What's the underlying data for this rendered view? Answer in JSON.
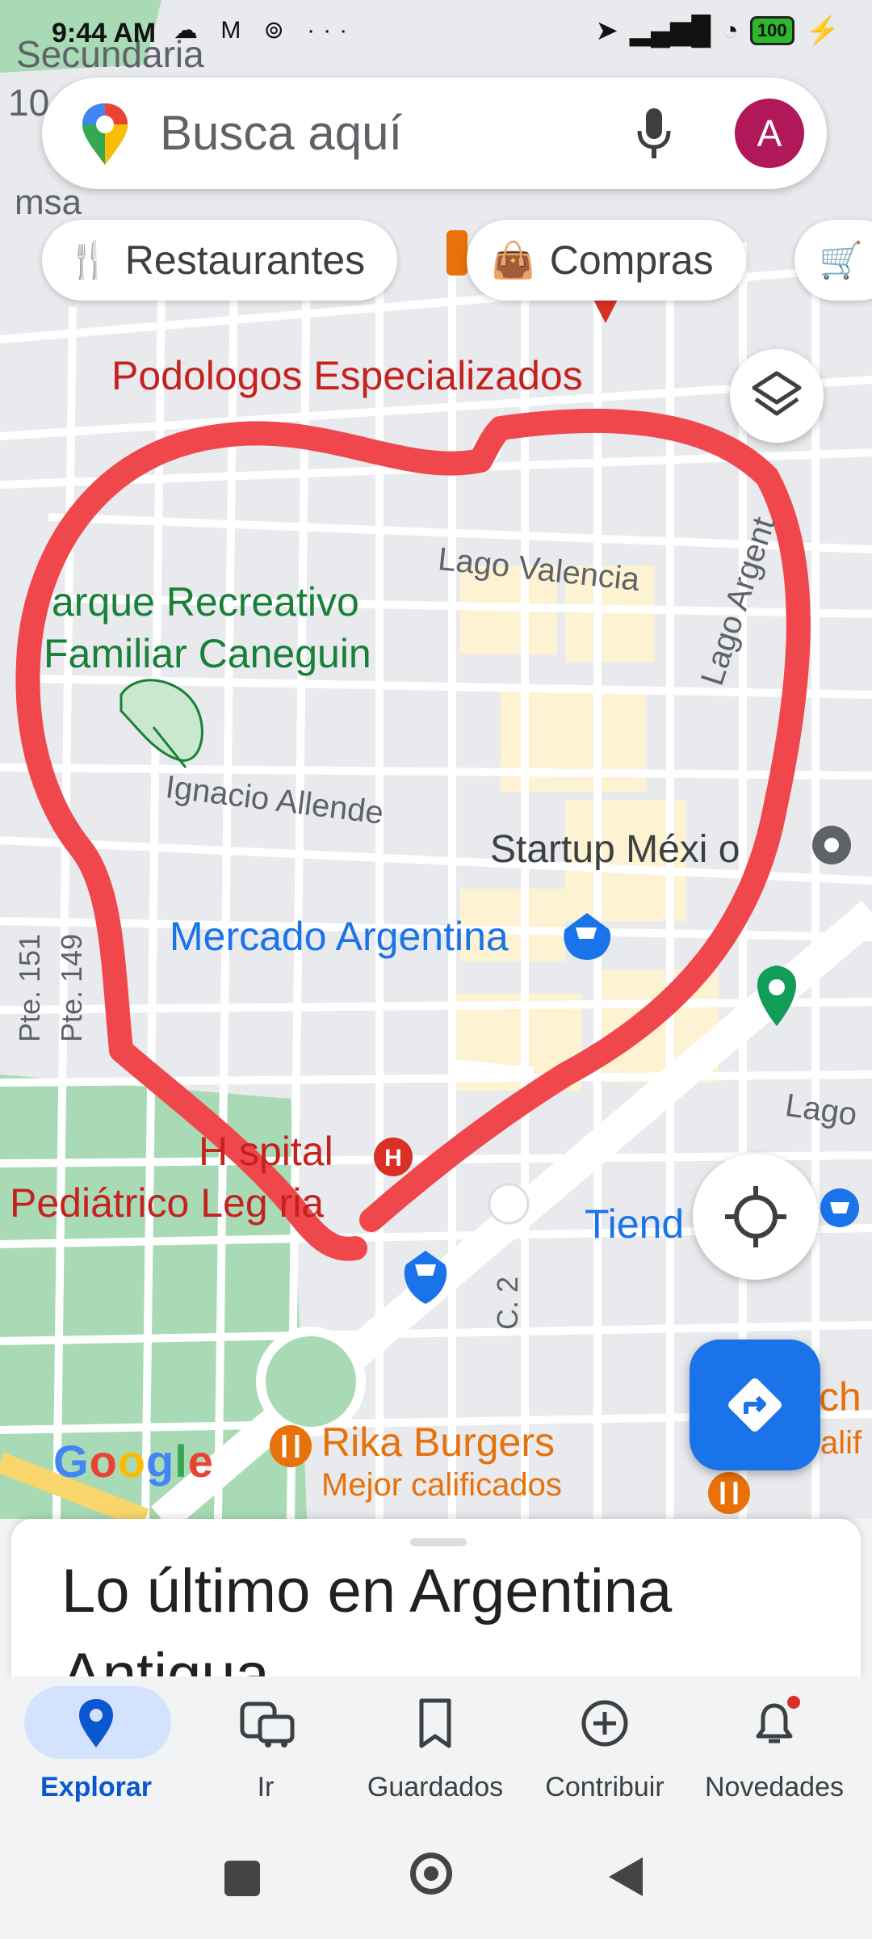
{
  "status_bar": {
    "time": "9:44 AM",
    "battery": "100"
  },
  "search": {
    "placeholder": "Busca aquí",
    "avatar_initial": "A"
  },
  "chips": [
    {
      "label": "Restaurantes",
      "icon": "fork-knife-icon"
    },
    {
      "label": "Compras",
      "icon": "shopping-bag-icon"
    }
  ],
  "map": {
    "labels": {
      "secundaria": "Secundaria",
      "secundaria_num": "10",
      "msa": "msa",
      "podologos": "Podologos Especializados",
      "lago_valencia": "Lago Valencia",
      "lago_argentina": "Lago Argent",
      "parque_line1": "arque Recreativo",
      "parque_line2": "Familiar Caneguin",
      "ignacio_allende": "Ignacio Allende",
      "startup_mexico": "Startup Méxi o",
      "mercado_argentina": "Mercado Argentina",
      "pte_151": "Pte. 151",
      "pte_149": "Pte. 149",
      "hospital": "H  spital",
      "pediatrico": "Pediátrico Leg ria",
      "tienda": "Tiend",
      "lago_right": "Lago",
      "c2": "C. 2",
      "rika_burgers": "Rika Burgers",
      "mejor_calificados": "Mejor calificados",
      "right_ch": "ch",
      "right_alif": "alif"
    },
    "google_logo": "Google",
    "colors": {
      "drawing": "#f0474c",
      "park": "#a8dab5",
      "road": "#ffffff",
      "poi_red": "#d93025",
      "poi_blue": "#1a73e8",
      "poi_orange": "#e8710a",
      "park_text": "#188038"
    }
  },
  "sheet": {
    "title": "Lo último en Argentina",
    "subtitle": "Antigua"
  },
  "bottom_nav": [
    {
      "label": "Explorar",
      "icon": "location-pin-icon",
      "active": true
    },
    {
      "label": "Ir",
      "icon": "commute-icon",
      "active": false
    },
    {
      "label": "Guardados",
      "icon": "bookmark-icon",
      "active": false
    },
    {
      "label": "Contribuir",
      "icon": "add-circle-icon",
      "active": false
    },
    {
      "label": "Novedades",
      "icon": "notification-bell-icon",
      "active": false
    }
  ],
  "accent_color": "#1a73e8"
}
